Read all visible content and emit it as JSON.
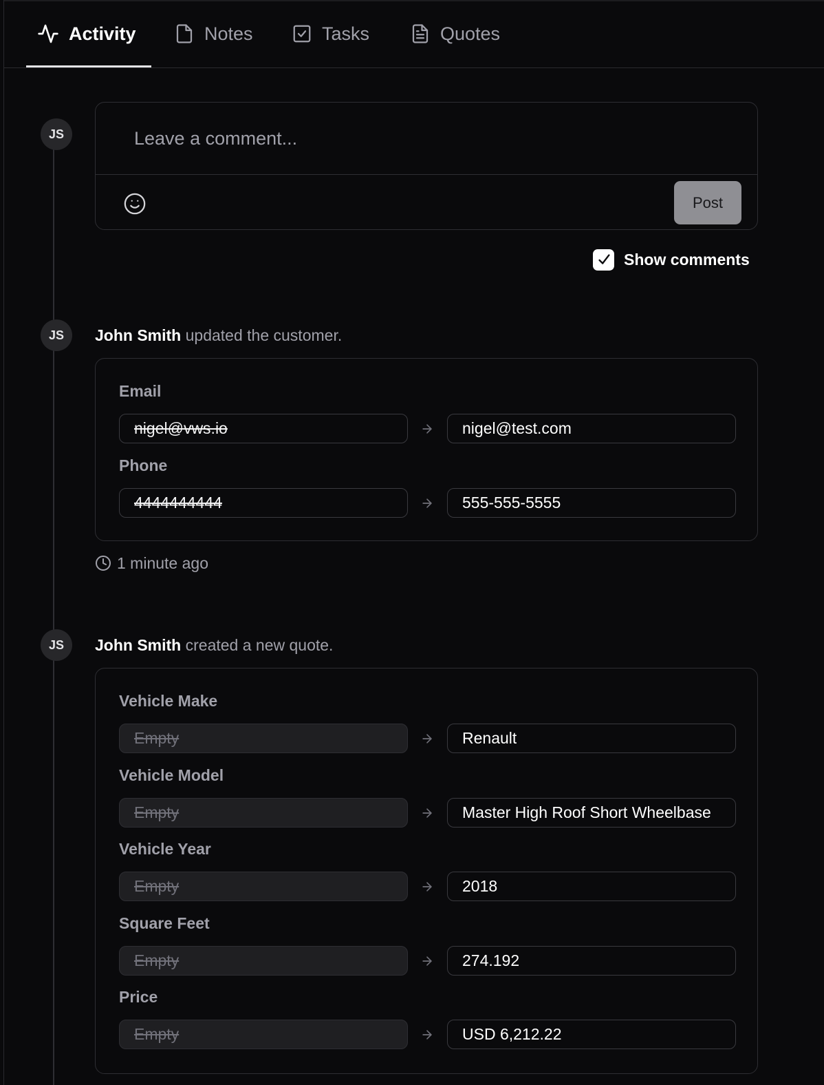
{
  "tabs": [
    {
      "label": "Activity",
      "icon": "activity-icon",
      "active": true
    },
    {
      "label": "Notes",
      "icon": "file-icon",
      "active": false
    },
    {
      "label": "Tasks",
      "icon": "checkbox-square-icon",
      "active": false
    },
    {
      "label": "Quotes",
      "icon": "file-text-icon",
      "active": false
    }
  ],
  "composer": {
    "avatar": "JS",
    "placeholder": "Leave a comment...",
    "post_label": "Post",
    "emoji_icon": "smiley-icon"
  },
  "show_comments": {
    "label": "Show comments",
    "checked": true
  },
  "events": [
    {
      "avatar": "JS",
      "actor": "John Smith",
      "action": "updated the customer.",
      "changes": [
        {
          "label": "Email",
          "old": "nigel@vws.io",
          "new": "nigel@test.com"
        },
        {
          "label": "Phone",
          "old": "4444444444",
          "new": "555-555-5555"
        }
      ],
      "timestamp": "1 minute ago"
    },
    {
      "avatar": "JS",
      "actor": "John Smith",
      "action": "created a new quote.",
      "changes": [
        {
          "label": "Vehicle Make",
          "old": "Empty",
          "new": "Renault"
        },
        {
          "label": "Vehicle Model",
          "old": "Empty",
          "new": "Master High Roof Short Wheelbase"
        },
        {
          "label": "Vehicle Year",
          "old": "Empty",
          "new": "2018"
        },
        {
          "label": "Square Feet",
          "old": "Empty",
          "new": "274.192"
        },
        {
          "label": "Price",
          "old": "Empty",
          "new": "USD 6,212.22"
        }
      ]
    }
  ],
  "colors": {
    "background": "#0a0a0c",
    "border": "#2e2e33",
    "muted_text": "#a1a1aa",
    "post_button": "#8f8f94"
  }
}
